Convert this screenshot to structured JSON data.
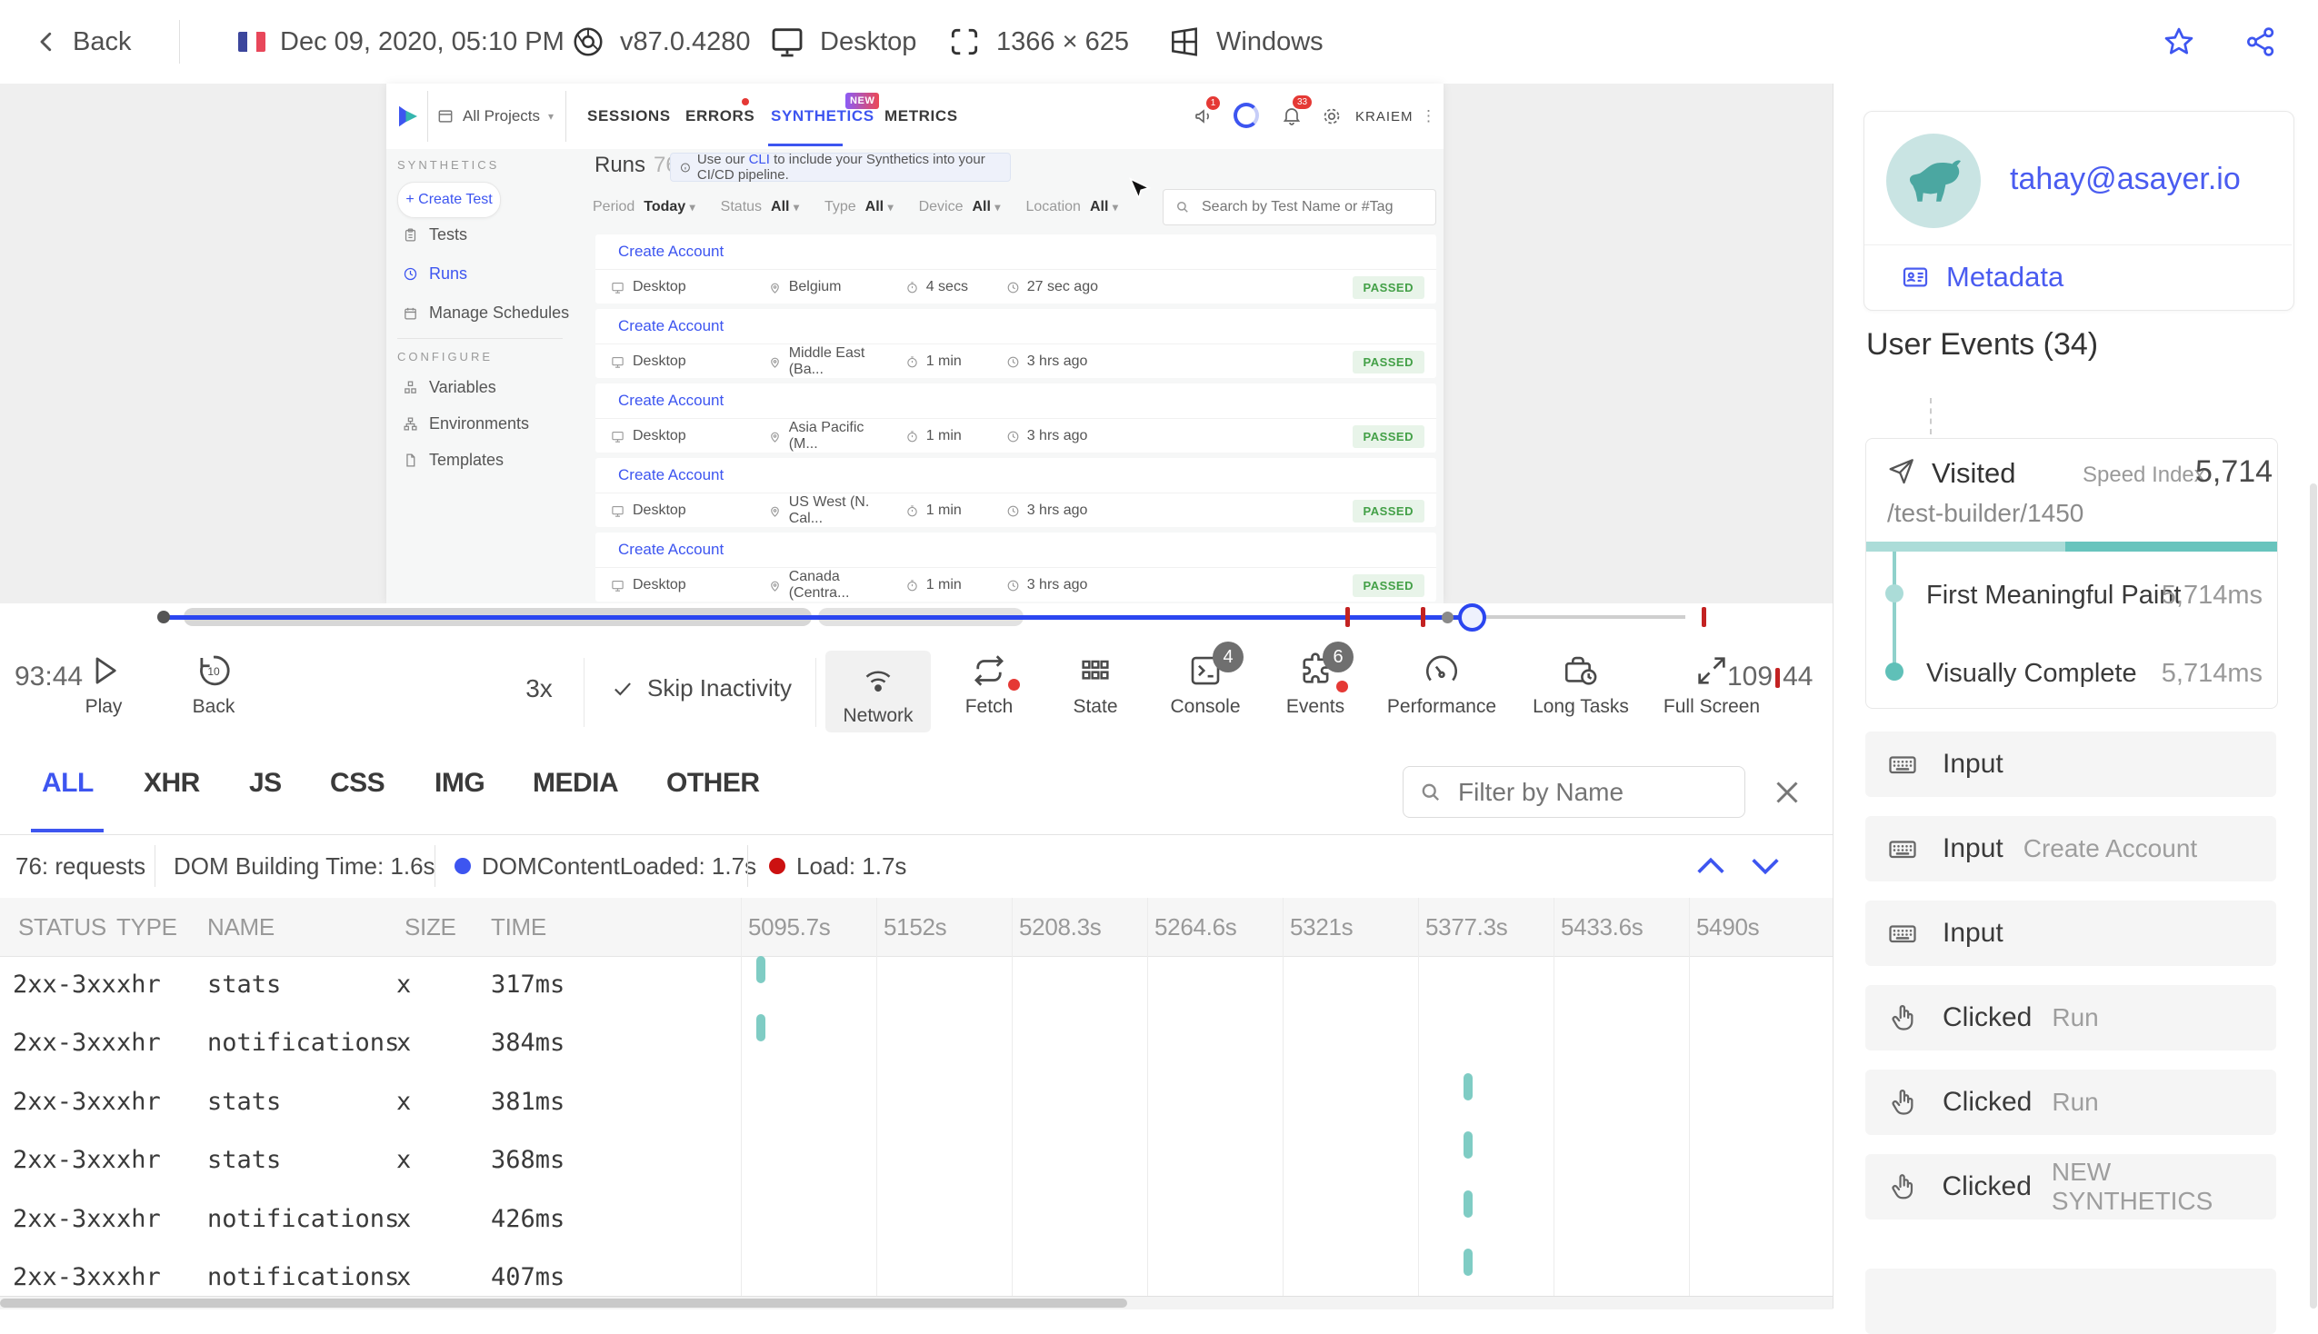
{
  "colors": {
    "accent_blue": "#3D55F0",
    "teal_bar": "#7FCCC4",
    "red_marker": "#C32222",
    "passed_green": "#43A047",
    "avatar_teal": "#4BA7A1",
    "event_card_bg": "#F5F5F5"
  },
  "top_bar": {
    "back_label": "Back",
    "session_date": "Dec 09, 2020, 05:10 PM",
    "browser_version": "v87.0.4280",
    "device": "Desktop",
    "resolution": "1366 × 625",
    "os": "Windows"
  },
  "replay_app": {
    "nav": {
      "project_selector": "All Projects",
      "tab_sessions": "SESSIONS",
      "tab_errors": "ERRORS",
      "tab_synthetics": "SYNTHETICS",
      "tab_metrics": "METRICS",
      "new_badge": "NEW",
      "announce_badge": "1",
      "bell_badge": "33",
      "user_name": "KRAIEM"
    },
    "sidebar": {
      "section_label": "SYNTHETICS",
      "create_test": "+ Create Test",
      "item_tests": "Tests",
      "item_runs": "Runs",
      "item_schedules": "Manage Schedules",
      "configure_label": "CONFIGURE",
      "item_variables": "Variables",
      "item_environments": "Environments",
      "item_templates": "Templates"
    },
    "content": {
      "title": "Runs",
      "count": "76",
      "banner_pre": "Use our ",
      "banner_link": "CLI",
      "banner_post": " to include your Synthetics into your CI/CD pipeline.",
      "filters": [
        {
          "label": "Period",
          "value": "Today"
        },
        {
          "label": "Status",
          "value": "All"
        },
        {
          "label": "Type",
          "value": "All"
        },
        {
          "label": "Device",
          "value": "All"
        },
        {
          "label": "Location",
          "value": "All"
        }
      ],
      "search_placeholder": "Search by Test Name or #Tag",
      "runs": [
        {
          "name": "Create Account",
          "device": "Desktop",
          "location": "Belgium",
          "duration": "4 secs",
          "ago": "27 sec ago",
          "status": "PASSED"
        },
        {
          "name": "Create Account",
          "device": "Desktop",
          "location": "Middle East (Ba...",
          "duration": "1 min",
          "ago": "3 hrs ago",
          "status": "PASSED"
        },
        {
          "name": "Create Account",
          "device": "Desktop",
          "location": "Asia Pacific (M...",
          "duration": "1 min",
          "ago": "3 hrs ago",
          "status": "PASSED"
        },
        {
          "name": "Create Account",
          "device": "Desktop",
          "location": "US West (N. Cal...",
          "duration": "1 min",
          "ago": "3 hrs ago",
          "status": "PASSED"
        },
        {
          "name": "Create Account",
          "device": "Desktop",
          "location": "Canada (Centra...",
          "duration": "1 min",
          "ago": "3 hrs ago",
          "status": "PASSED"
        }
      ]
    }
  },
  "player": {
    "current_time": "93:44",
    "total_minutes": "109",
    "total_seconds": "44",
    "play_label": "Play",
    "back_label": "Back",
    "speed": "3x",
    "skip_label": "Skip Inactivity",
    "network_label": "Network",
    "fetch_label": "Fetch",
    "state_label": "State",
    "console_label": "Console",
    "console_badge": "4",
    "events_label": "Events",
    "events_badge": "6",
    "performance_label": "Performance",
    "long_tasks_label": "Long Tasks",
    "full_screen_label": "Full Screen"
  },
  "network_panel": {
    "tabs": [
      "ALL",
      "XHR",
      "JS",
      "CSS",
      "IMG",
      "MEDIA",
      "OTHER"
    ],
    "active_tab": "ALL",
    "filter_placeholder": "Filter by Name",
    "requests": "76: requests",
    "dom_building": "DOM Building Time: 1.6s",
    "dom_content_loaded": "DOMContentLoaded: 1.7s",
    "load": "Load: 1.7s",
    "columns": [
      "STATUS",
      "TYPE",
      "NAME",
      "SIZE",
      "TIME"
    ],
    "time_columns": [
      "5095.7s",
      "5152s",
      "5208.3s",
      "5264.6s",
      "5321s",
      "5377.3s",
      "5433.6s",
      "5490s"
    ],
    "rows": [
      {
        "status": "2xx-3xx",
        "type": "xhr",
        "name": "stats",
        "size": "x",
        "time": "317ms"
      },
      {
        "status": "2xx-3xx",
        "type": "xhr",
        "name": "notifications",
        "size": "x",
        "time": "384ms"
      },
      {
        "status": "2xx-3xx",
        "type": "xhr",
        "name": "stats",
        "size": "x",
        "time": "381ms"
      },
      {
        "status": "2xx-3xx",
        "type": "xhr",
        "name": "stats",
        "size": "x",
        "time": "368ms"
      },
      {
        "status": "2xx-3xx",
        "type": "xhr",
        "name": "notifications",
        "size": "x",
        "time": "426ms"
      },
      {
        "status": "2xx-3xx",
        "type": "xhr",
        "name": "notifications",
        "size": "x",
        "time": "407ms"
      }
    ]
  },
  "user_sidebar": {
    "email": "tahay@asayer.io",
    "metadata_label": "Metadata",
    "events_title": "User Events (34)",
    "visited": {
      "label": "Visited",
      "speed_index_label": "Speed Index",
      "speed_index": "5,714",
      "url": "/test-builder/1450",
      "metrics": [
        {
          "label": "First Meaningful Paint",
          "value": "5,714ms"
        },
        {
          "label": "Visually Complete",
          "value": "5,714ms"
        }
      ]
    },
    "events": [
      {
        "type": "Input",
        "detail": ""
      },
      {
        "type": "Input",
        "detail": "Create Account"
      },
      {
        "type": "Input",
        "detail": ""
      },
      {
        "type": "Clicked",
        "detail": "Run"
      },
      {
        "type": "Clicked",
        "detail": "Run"
      },
      {
        "type": "Clicked",
        "detail": "NEW SYNTHETICS"
      }
    ]
  }
}
